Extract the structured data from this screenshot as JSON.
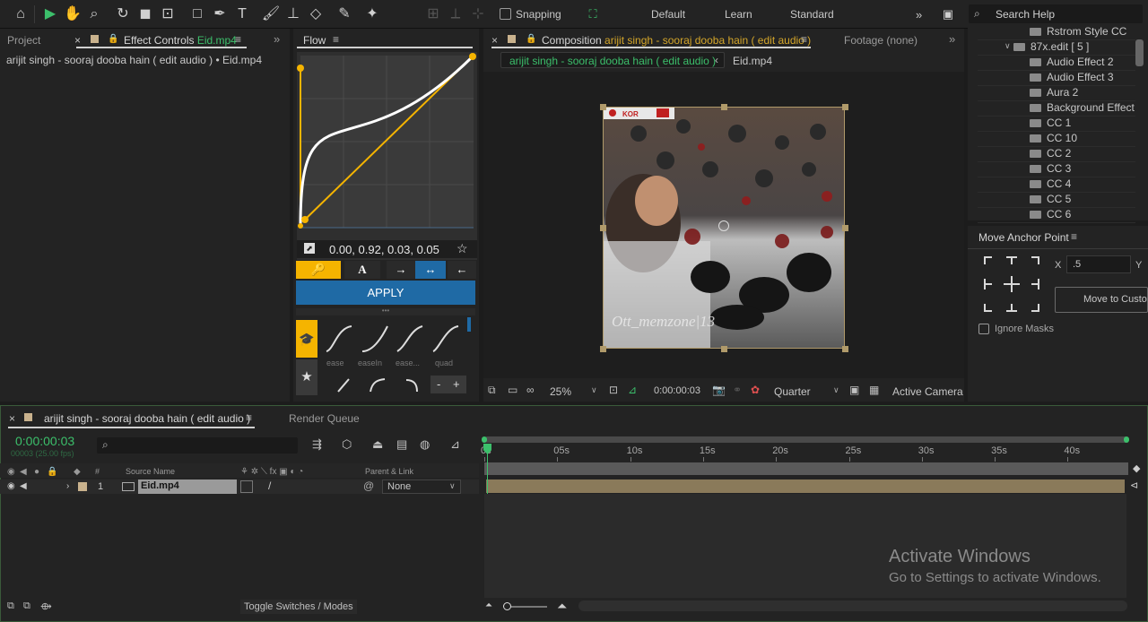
{
  "toolbar": {
    "snapping_label": "Snapping",
    "workspaces": [
      "Default",
      "Learn",
      "Standard"
    ],
    "search_placeholder": "Search Help"
  },
  "left_panel": {
    "tab_project": "Project",
    "tab_effect_controls_prefix": "Effect Controls",
    "tab_effect_controls_file": "Eid.mp4",
    "breadcrumb": "arijit singh - sooraj dooba hain ( edit audio ) • Eid.mp4"
  },
  "flow": {
    "title": "Flow",
    "curve_values": "0.00, 0.92, 0.03, 0.05",
    "apply_label": "APPLY",
    "presets": [
      "ease",
      "easeIn",
      "ease...",
      "quad"
    ],
    "minus_label": "-",
    "plus_label": "+",
    "curve": [
      0.0,
      0.92,
      0.03,
      0.05
    ]
  },
  "composition": {
    "tab_prefix": "Composition",
    "tab_name": "arijit singh - sooraj dooba hain ( edit audio )",
    "tab_footage": "Footage  (none)",
    "nav_comp": "arijit singh - sooraj dooba hain ( edit audio )",
    "nav_layer": "Eid.mp4",
    "watermark": "Ott_memzone|13",
    "scoreboard": "KOR",
    "zoom": "25%",
    "timecode": "0:00:00:03",
    "resolution": "Quarter",
    "camera": "Active Camera"
  },
  "project_tree": {
    "items": [
      {
        "label": "Rstrom Style CC",
        "indent": 1
      },
      {
        "label": "87x.edit [ 5 ]",
        "indent": 0,
        "expanded": true
      },
      {
        "label": "Audio Effect 2",
        "indent": 1
      },
      {
        "label": "Audio Effect 3",
        "indent": 1
      },
      {
        "label": "Aura 2",
        "indent": 1
      },
      {
        "label": "Background Effect",
        "indent": 1
      },
      {
        "label": "CC 1",
        "indent": 1
      },
      {
        "label": "CC 10",
        "indent": 1
      },
      {
        "label": "CC 2",
        "indent": 1
      },
      {
        "label": "CC 3",
        "indent": 1
      },
      {
        "label": "CC 4",
        "indent": 1
      },
      {
        "label": "CC 5",
        "indent": 1
      },
      {
        "label": "CC 6",
        "indent": 1
      }
    ]
  },
  "anchor": {
    "title": "Move Anchor Point",
    "x_label": "X",
    "x_value": ".5",
    "y_label": "Y",
    "move_button": "Move to Custo",
    "ignore_masks": "Ignore Masks"
  },
  "timeline": {
    "tab_comp": "arijit singh - sooraj dooba hain ( edit audio )",
    "tab_render": "Render Queue",
    "timecode": "0:00:00:03",
    "fps": "00003 (25.00 fps)",
    "ticks": [
      "0s",
      "05s",
      "10s",
      "15s",
      "20s",
      "25s",
      "30s",
      "35s",
      "40s"
    ],
    "col_source": "Source Name",
    "col_parent": "Parent & Link",
    "layer_num": "1",
    "layer_name": "Eid.mp4",
    "parent_value": "None",
    "toggle_label": "Toggle Switches / Modes"
  },
  "windows": {
    "activate_title": "Activate Windows",
    "activate_sub": "Go to Settings to activate Windows."
  }
}
